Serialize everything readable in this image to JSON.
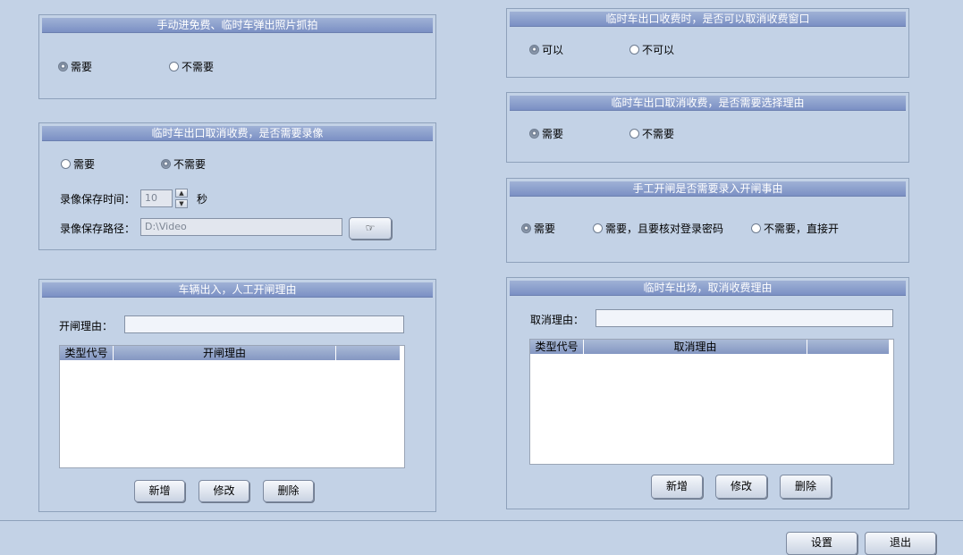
{
  "panel_snapshot": {
    "title": "手动进免费、临时车弹出照片抓拍",
    "opt_yes": "需要",
    "opt_no": "不需要"
  },
  "panel_cancel_window": {
    "title": "临时车出口收费时，是否可以取消收费窗口",
    "opt_yes": "可以",
    "opt_no": "不可以"
  },
  "panel_cancel_reason_select": {
    "title": "临时车出口取消收费，是否需要选择理由",
    "opt_yes": "需要",
    "opt_no": "不需要"
  },
  "panel_record": {
    "title": "临时车出口取消收费，是否需要录像",
    "opt_yes": "需要",
    "opt_no": "不需要",
    "save_time_label": "录像保存时间：",
    "save_time_value": "10",
    "save_time_unit": "秒",
    "save_path_label": "录像保存路径：",
    "save_path_value": "D:\\Video",
    "browse_icon": "pointing-hand-icon"
  },
  "panel_manual_open": {
    "title": "手工开闸是否需要录入开闸事由",
    "opt1": "需要",
    "opt2": "需要，且要核对登录密码",
    "opt3": "不需要，直接开"
  },
  "panel_vehicle_reason": {
    "title": "车辆出入，人工开闸理由",
    "reason_label": "开闸理由：",
    "columns": [
      "类型代号",
      "开闸理由",
      ""
    ],
    "add": "新增",
    "edit": "修改",
    "delete": "删除"
  },
  "panel_cancel_reason": {
    "title": "临时车出场，取消收费理由",
    "reason_label": "取消理由：",
    "columns": [
      "类型代号",
      "取消理由",
      ""
    ],
    "add": "新增",
    "edit": "修改",
    "delete": "删除"
  },
  "footer": {
    "settings": "设置",
    "exit": "退出"
  }
}
